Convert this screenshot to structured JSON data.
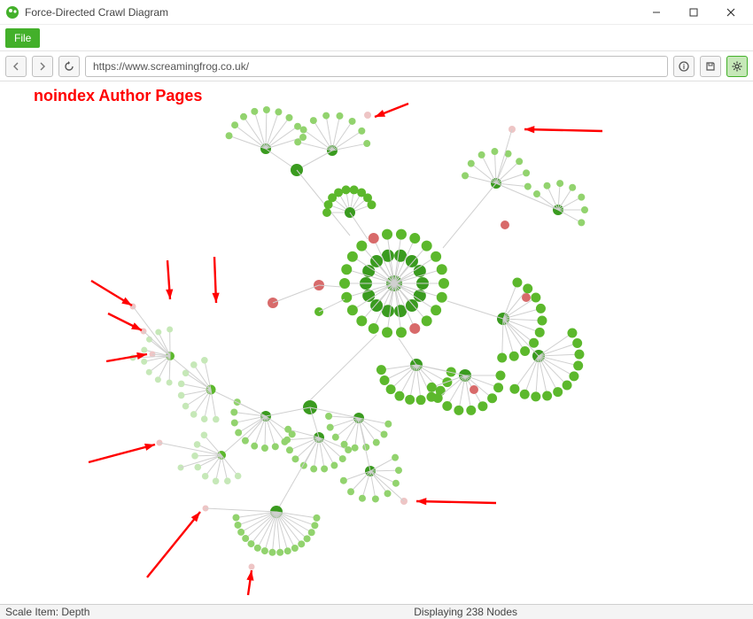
{
  "window": {
    "title": "Force-Directed Crawl Diagram"
  },
  "menu": {
    "file_label": "File"
  },
  "toolbar": {
    "url_value": "https://www.screamingfrog.co.uk/"
  },
  "annotation": {
    "headline": "noindex Author Pages"
  },
  "status": {
    "scale_label": "Scale Item: Depth",
    "nodes_label": "Displaying 238 Nodes"
  },
  "colors": {
    "green_core": "#3a9b1f",
    "green_mid": "#5cb82c",
    "green_light": "#92d36e",
    "green_pale": "#c6e8b8",
    "red": "#d86a6a",
    "red_pale": "#eec5c5",
    "arrow": "#ff0000",
    "edge": "#d0d0d0"
  }
}
